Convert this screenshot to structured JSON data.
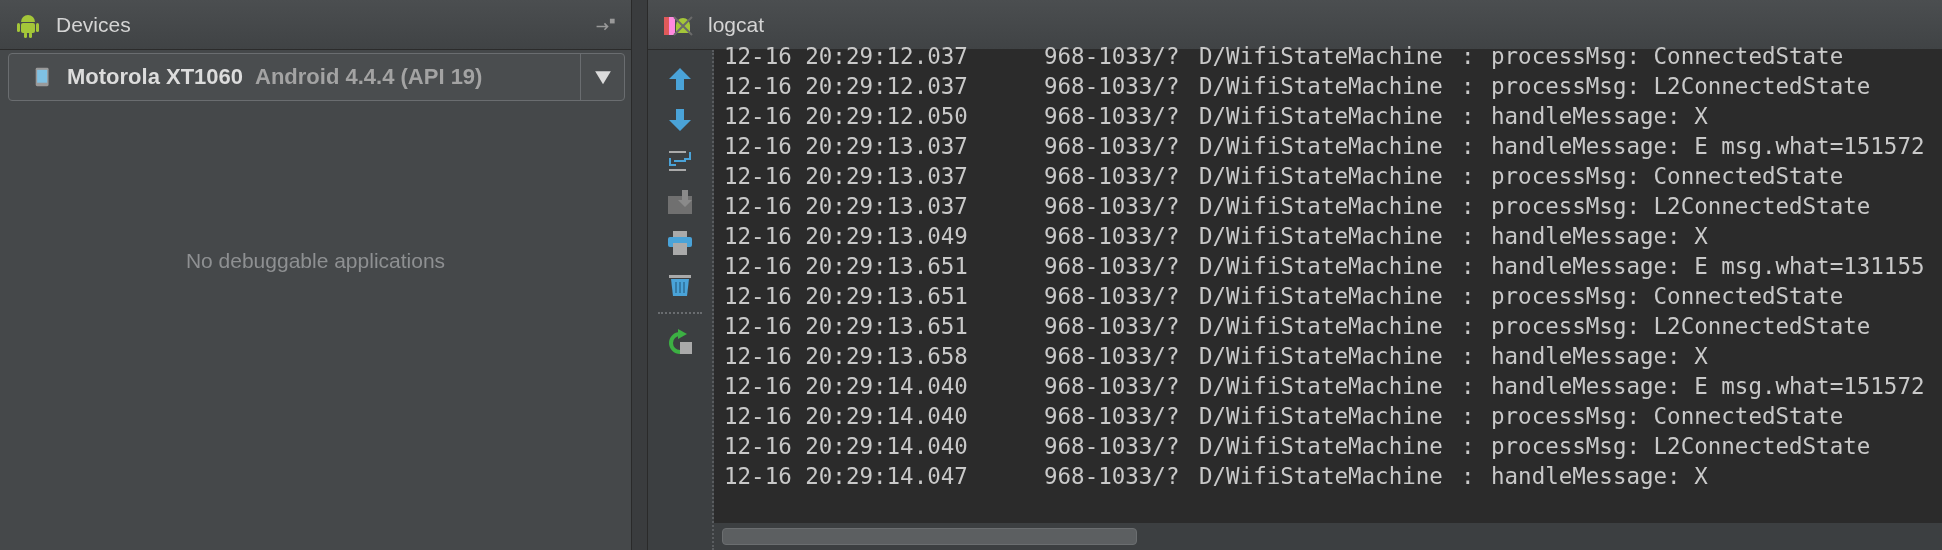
{
  "devices_panel": {
    "title": "Devices",
    "device_selector": {
      "device": "Motorola XT1060",
      "detail": "Android 4.4.4 (API 19)"
    },
    "empty_message": "No debuggable applications"
  },
  "logcat_panel": {
    "title": "logcat",
    "rows": [
      {
        "time": "12-16 20:29:12.037",
        "pid": "968-1033/?",
        "tag": "D/WifiStateMachine",
        "sep": ":",
        "message": "processMsg: ConnectedState"
      },
      {
        "time": "12-16 20:29:12.037",
        "pid": "968-1033/?",
        "tag": "D/WifiStateMachine",
        "sep": ":",
        "message": "processMsg: L2ConnectedState"
      },
      {
        "time": "12-16 20:29:12.050",
        "pid": "968-1033/?",
        "tag": "D/WifiStateMachine",
        "sep": ":",
        "message": "handleMessage: X"
      },
      {
        "time": "12-16 20:29:13.037",
        "pid": "968-1033/?",
        "tag": "D/WifiStateMachine",
        "sep": ":",
        "message": "handleMessage: E msg.what=151572"
      },
      {
        "time": "12-16 20:29:13.037",
        "pid": "968-1033/?",
        "tag": "D/WifiStateMachine",
        "sep": ":",
        "message": "processMsg: ConnectedState"
      },
      {
        "time": "12-16 20:29:13.037",
        "pid": "968-1033/?",
        "tag": "D/WifiStateMachine",
        "sep": ":",
        "message": "processMsg: L2ConnectedState"
      },
      {
        "time": "12-16 20:29:13.049",
        "pid": "968-1033/?",
        "tag": "D/WifiStateMachine",
        "sep": ":",
        "message": "handleMessage: X"
      },
      {
        "time": "12-16 20:29:13.651",
        "pid": "968-1033/?",
        "tag": "D/WifiStateMachine",
        "sep": ":",
        "message": "handleMessage: E msg.what=131155"
      },
      {
        "time": "12-16 20:29:13.651",
        "pid": "968-1033/?",
        "tag": "D/WifiStateMachine",
        "sep": ":",
        "message": "processMsg: ConnectedState"
      },
      {
        "time": "12-16 20:29:13.651",
        "pid": "968-1033/?",
        "tag": "D/WifiStateMachine",
        "sep": ":",
        "message": "processMsg: L2ConnectedState"
      },
      {
        "time": "12-16 20:29:13.658",
        "pid": "968-1033/?",
        "tag": "D/WifiStateMachine",
        "sep": ":",
        "message": "handleMessage: X"
      },
      {
        "time": "12-16 20:29:14.040",
        "pid": "968-1033/?",
        "tag": "D/WifiStateMachine",
        "sep": ":",
        "message": "handleMessage: E msg.what=151572"
      },
      {
        "time": "12-16 20:29:14.040",
        "pid": "968-1033/?",
        "tag": "D/WifiStateMachine",
        "sep": ":",
        "message": "processMsg: ConnectedState"
      },
      {
        "time": "12-16 20:29:14.040",
        "pid": "968-1033/?",
        "tag": "D/WifiStateMachine",
        "sep": ":",
        "message": "processMsg: L2ConnectedState"
      },
      {
        "time": "12-16 20:29:14.047",
        "pid": "968-1033/?",
        "tag": "D/WifiStateMachine",
        "sep": ":",
        "message": "handleMessage: X"
      }
    ]
  }
}
